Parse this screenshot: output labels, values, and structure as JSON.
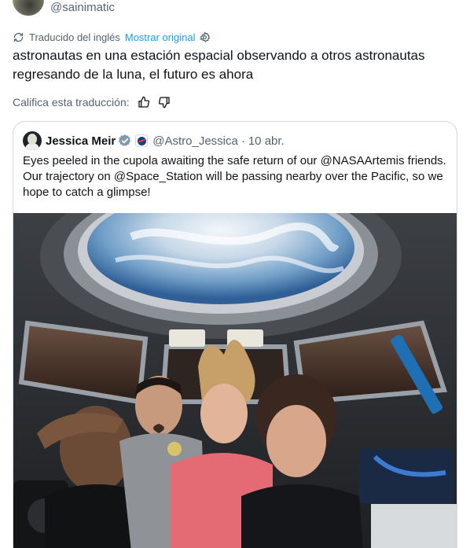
{
  "author": {
    "handle": "@sainimatic"
  },
  "translation": {
    "label": "Traducido del inglés",
    "show_original": "Mostrar original"
  },
  "tweet": {
    "text": "astronautas en una estación espacial observando a otros astronautas regresando de la luna, el futuro es ahora"
  },
  "rating": {
    "label": "Califica esta traducción:"
  },
  "quote": {
    "name": "Jessica Meir",
    "handle": "@Astro_Jessica",
    "separator": "·",
    "date": "10 abr.",
    "text": "Eyes peeled in the cupola awaiting the safe return of our @NASAArtemis friends. Our trajectory on @Space_Station will be passing nearby over the Pacific, so we hope to catch a glimpse!"
  },
  "colors": {
    "link": "#1d9bf0",
    "secondary_text": "#536471",
    "verified": "#829aab",
    "border": "#cfd9de"
  },
  "icons": [
    "translate-icon",
    "settings-icon",
    "thumbs-up-icon",
    "thumbs-down-icon",
    "verified-badge-icon",
    "nasa-logo-icon"
  ]
}
